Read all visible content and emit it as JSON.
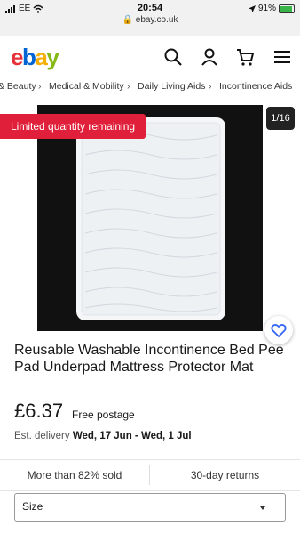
{
  "status_bar": {
    "carrier": "EE",
    "time": "20:54",
    "url": "ebay.co.uk",
    "battery": "91%",
    "battery_level": 0.91
  },
  "header": {
    "logo": {
      "e": "e",
      "b": "b",
      "a": "a",
      "y": "y"
    },
    "icons": [
      "search-icon",
      "user-icon",
      "cart-icon",
      "menu-icon"
    ]
  },
  "breadcrumbs": [
    "& Beauty",
    "Medical & Mobility",
    "Daily Living Aids",
    "Incontinence Aids"
  ],
  "gallery": {
    "badge": "Limited quantity remaining",
    "counter": "1/16"
  },
  "listing": {
    "title": "Reusable Washable Incontinence Bed Pee Pad Underpad Mattress Protector Mat",
    "price": "£6.37",
    "postage": "Free postage",
    "delivery_label": "Est. delivery",
    "delivery_dates": "Wed, 17 Jun - Wed, 1 Jul",
    "sold": "More than 82% sold",
    "returns": "30-day returns",
    "size_label": "Size"
  },
  "colors": {
    "accent_red": "#e0203a",
    "ebay_red": "#e53238",
    "ebay_blue": "#0064d2",
    "ebay_yellow": "#f5af02",
    "ebay_green": "#86b817"
  }
}
